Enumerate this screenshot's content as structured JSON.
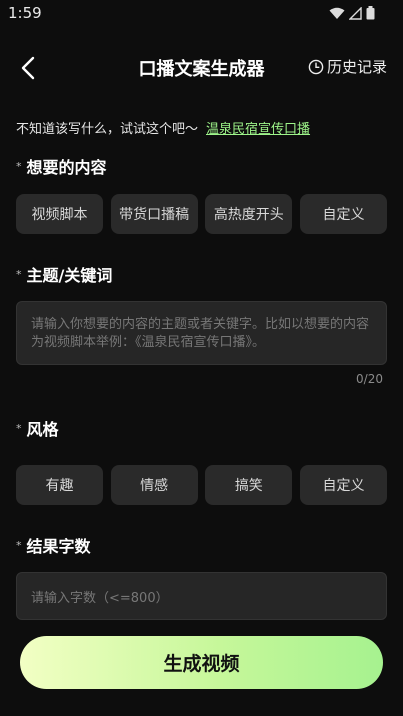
{
  "status_bar": {
    "time": "1:59"
  },
  "header": {
    "title": "口播文案生成器",
    "history_label": "历史记录"
  },
  "hint": {
    "text": "不知道该写什么，试试这个吧～",
    "example_link": "温泉民宿宣传口播"
  },
  "content_section": {
    "asterisk": "*",
    "label": "想要的内容",
    "options": [
      "视频脚本",
      "带货口播稿",
      "高热度开头",
      "自定义"
    ]
  },
  "topic_section": {
    "asterisk": "*",
    "label": "主题/关键词",
    "placeholder": "请输入你想要的内容的主题或者关键字。比如以想要的内容为视频脚本举例：《温泉民宿宣传口播》。",
    "counter": "0/20"
  },
  "style_section": {
    "asterisk": "*",
    "label": "风格",
    "options": [
      "有趣",
      "情感",
      "搞笑",
      "自定义"
    ]
  },
  "word_count_section": {
    "asterisk": "*",
    "label": "结果字数",
    "placeholder": "请输入字数（<=800）"
  },
  "generate_button": {
    "label": "生成视频"
  },
  "colors": {
    "background": "#0d0d0d",
    "accent": "#9ef58a",
    "chip": "#2a2a2a"
  }
}
